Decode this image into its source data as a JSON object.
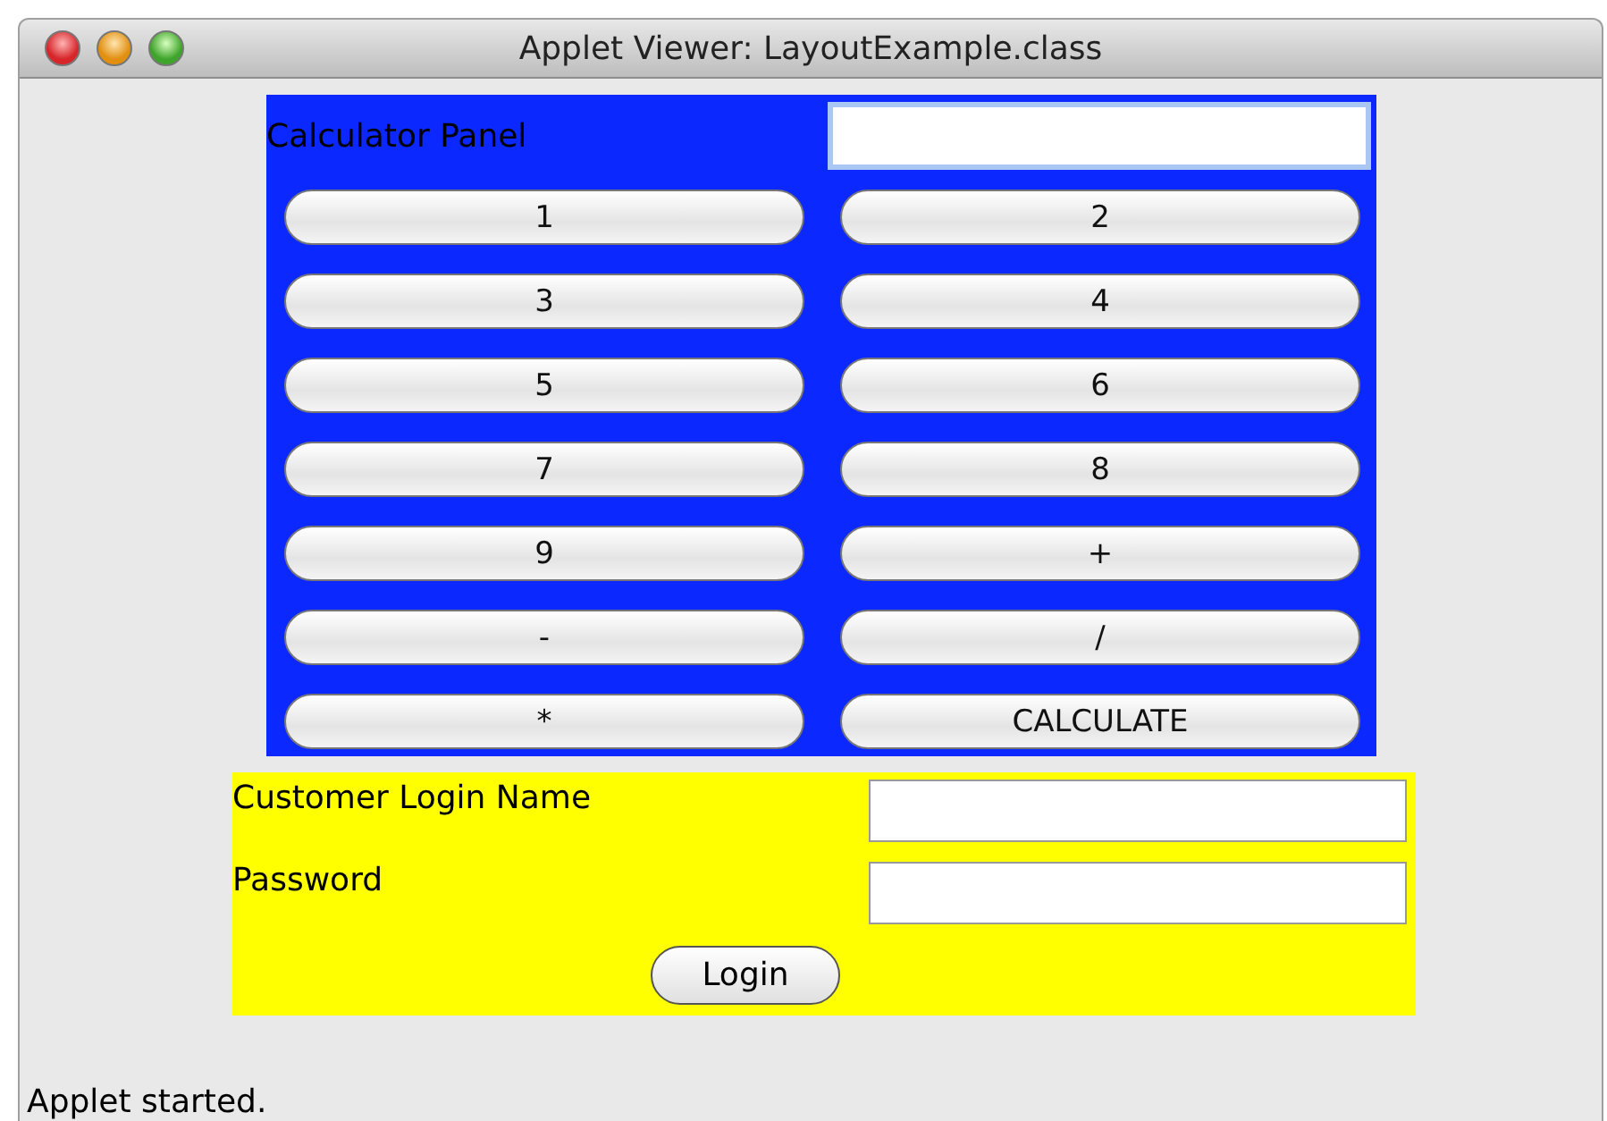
{
  "window": {
    "title": "Applet Viewer: LayoutExample.class"
  },
  "calculator": {
    "label": "Calculator Panel",
    "keys": [
      "1",
      "2",
      "3",
      "4",
      "5",
      "6",
      "7",
      "8",
      "9",
      "+",
      "-",
      "/",
      "*",
      "CALCULATE"
    ]
  },
  "login": {
    "fields": [
      {
        "label": "Customer Login Name"
      },
      {
        "label": "Password"
      }
    ],
    "button": "Login"
  },
  "status_bar": "Applet started."
}
